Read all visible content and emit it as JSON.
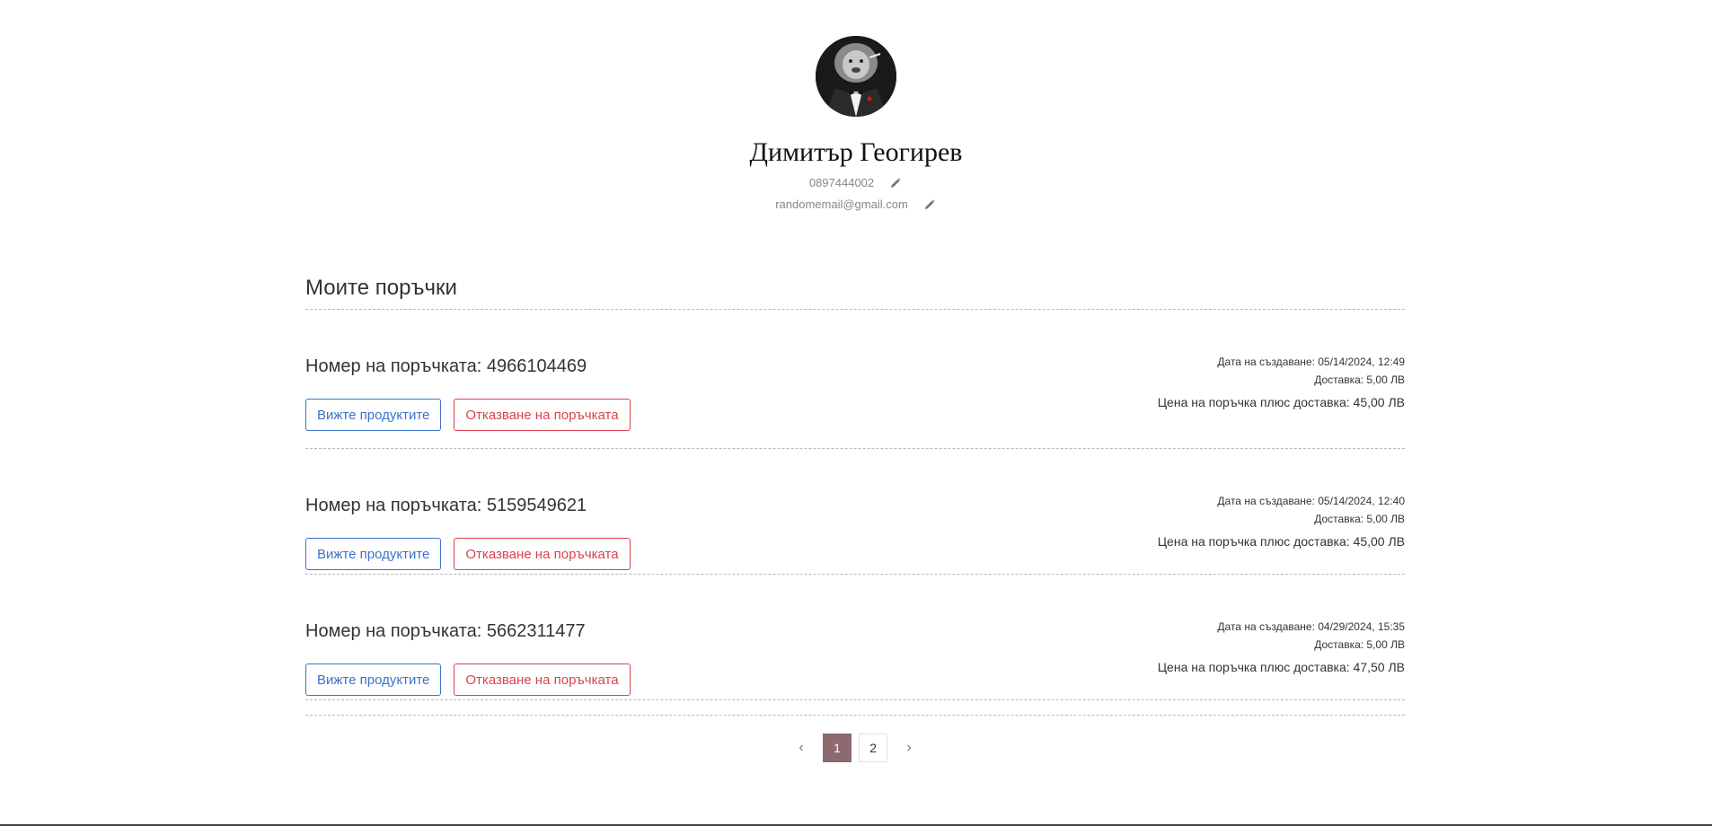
{
  "profile": {
    "name": "Димитър Геогирев",
    "phone": "0897444002",
    "email": "randomemail@gmail.com",
    "avatar_icon": "lion-in-tuxedo-avatar"
  },
  "orders_section": {
    "title": "Моите поръчки"
  },
  "orders": [
    {
      "number_label": "Номер на поръчката: 4966104469",
      "created": "Дата на създаване: 05/14/2024, 12:49",
      "delivery": "Доставка: 5,00 ЛВ",
      "total": "Цена на поръчка плюс доставка: 45,00 ЛВ",
      "view_label": "Вижте продуктите",
      "cancel_label": "Отказване на поръчката"
    },
    {
      "number_label": "Номер на поръчката: 5159549621",
      "created": "Дата на създаване: 05/14/2024, 12:40",
      "delivery": "Доставка: 5,00 ЛВ",
      "total": "Цена на поръчка плюс доставка: 45,00 ЛВ",
      "view_label": "Вижте продуктите",
      "cancel_label": "Отказване на поръчката"
    },
    {
      "number_label": "Номер на поръчката: 5662311477",
      "created": "Дата на създаване: 04/29/2024, 15:35",
      "delivery": "Доставка: 5,00 ЛВ",
      "total": "Цена на поръчка плюс доставка: 47,50 ЛВ",
      "view_label": "Вижте продуктите",
      "cancel_label": "Отказване на поръчката"
    }
  ],
  "pagination": {
    "prev_icon": "‹",
    "next_icon": "›",
    "pages": [
      "1",
      "2"
    ],
    "current_page": "1"
  },
  "colors": {
    "view_button": "#3b73c9",
    "cancel_button": "#d9434f",
    "active_page": "#8c6a6f"
  }
}
